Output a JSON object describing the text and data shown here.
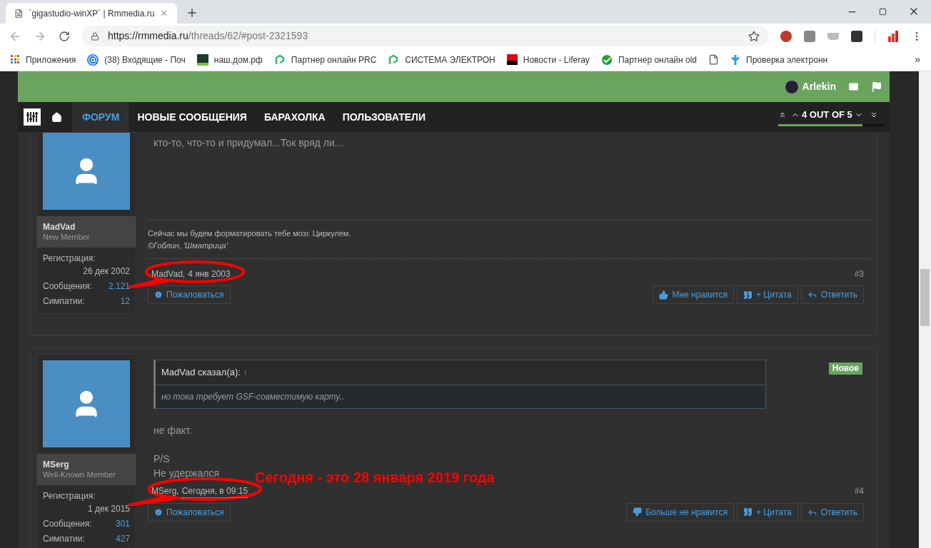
{
  "browser": {
    "tab": {
      "title": "`gigastudio-winXP` | Rmmedia.ru"
    },
    "url": {
      "host": "https://rmmedia.ru",
      "path": "/threads/62/#post-2321593"
    },
    "bookmarks": [
      {
        "kind": "apps",
        "label": "Приложения"
      },
      {
        "kind": "mail",
        "label": "(38) Входящие - Поч"
      },
      {
        "kind": "home",
        "label": "наш.дом.рф"
      },
      {
        "kind": "partner",
        "label": "Партнер онлайн PRC"
      },
      {
        "kind": "partner",
        "label": "СИСТЕМА ЭЛЕКТРОН"
      },
      {
        "kind": "news",
        "label": "Новости - Liferay"
      },
      {
        "kind": "bank",
        "label": "Партнер онлайн old"
      },
      {
        "kind": "page"
      },
      {
        "kind": "check",
        "label": "Проверка электронн"
      }
    ],
    "more": "»"
  },
  "forum": {
    "user": "Arlekin",
    "nav": [
      {
        "label": "ФОРУМ",
        "selected": true
      },
      {
        "label": "НОВЫЕ СООБЩЕНИЯ",
        "selected": false
      },
      {
        "label": "БАРАХОЛКА",
        "selected": false
      },
      {
        "label": "ПОЛЬЗОВАТЕЛИ",
        "selected": false
      }
    ],
    "pager": {
      "label": "4 OUT OF 5",
      "level": 0.8
    }
  },
  "posts": [
    {
      "author": "MadVad",
      "title": "New Member",
      "stats": [
        {
          "label": "Регистрация:",
          "value": "26 дек 2002"
        },
        {
          "label": "Сообщения:",
          "value": "2.121"
        },
        {
          "label": "Симпатии:",
          "value": "12"
        }
      ],
      "body": [
        "кто-то, что-то и придумал...Ток вряд ли..."
      ],
      "signature": {
        "text": "Сейчас мы будем форматировать тебе мозг. Циркулем.",
        "source": "©Гоблин, 'Шматрица'"
      },
      "date": {
        "author": "MadVad,",
        "time": "4 янв 2003"
      },
      "circled": true,
      "number": "#3",
      "report": "Пожаловаться",
      "actions": [
        {
          "kind": "like",
          "label": "Мне нравится"
        },
        {
          "kind": "quote",
          "label": "+ Цитата"
        },
        {
          "kind": "reply",
          "label": "Ответить"
        }
      ]
    },
    {
      "author": "MSerg",
      "title": "Well-Known Member",
      "stats": [
        {
          "label": "Регистрация:",
          "value": "1 дек 2015"
        },
        {
          "label": "Сообщения:",
          "value": "301"
        },
        {
          "label": "Симпатии:",
          "value": "427"
        }
      ],
      "quote": {
        "author": "MadVad сказал(а):",
        "arrow": "↑",
        "text": "но тока требует GSF-совместимую карту.."
      },
      "badge": "Новое",
      "body": [
        "не факт.",
        "P/S",
        "Не удержался"
      ],
      "date": {
        "author": "MSerg,",
        "time": "Сегодня, в 09:15"
      },
      "circled": true,
      "number": "#4",
      "report": "Пожаловаться",
      "actions": [
        {
          "kind": "unlike",
          "label": "Больше не нравится"
        },
        {
          "kind": "quote",
          "label": "+ Цитата"
        },
        {
          "kind": "reply",
          "label": "Ответить"
        }
      ]
    }
  ],
  "annotation": "Сегодня - это 28 января 2019 года"
}
